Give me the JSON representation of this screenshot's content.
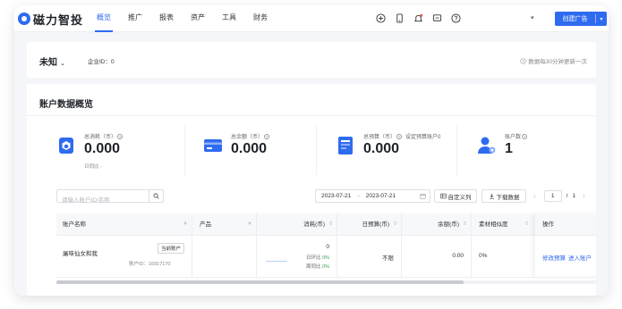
{
  "app": {
    "logo_text": "磁力智投",
    "nav": [
      "概览",
      "推广",
      "报表",
      "资产",
      "工具",
      "财务"
    ],
    "active_nav": "概览",
    "create_button": "创建广告",
    "user_caret": "▾",
    "top_icons": [
      "add-circle-icon",
      "phone-icon",
      "bell-icon",
      "message-icon",
      "help-icon"
    ]
  },
  "account": {
    "name": "未知",
    "id_label": "企业ID：",
    "id_value": "0",
    "refresh_note": "数据每30分钟更新一次"
  },
  "overview": {
    "title": "账户数据概览",
    "stats": [
      {
        "label": "总消耗（币）",
        "value": "0.000",
        "sub": "日同比 -",
        "icon": "cube-icon",
        "color": "#2f6bf0"
      },
      {
        "label": "总余额（币）",
        "value": "0.000",
        "sub": "",
        "icon": "wallet-card-icon",
        "color": "#2f6bf0"
      },
      {
        "label": "总预算（币）",
        "value": "0.000",
        "sub": "",
        "extra": "设定预算账户0",
        "icon": "budget-doc-icon",
        "color": "#2f6bf0"
      },
      {
        "label": "账户数",
        "value": "1",
        "sub": "",
        "icon": "user-settings-icon",
        "color": "#2f6bf0"
      }
    ]
  },
  "toolbar": {
    "search_placeholder": "请输入账户ID/名称",
    "date_start": "2023-07-21",
    "date_sep": "→",
    "date_end": "2023-07-21",
    "custom_columns": "自定义列",
    "download": "下载数据",
    "page_current": "1",
    "page_sep": "/",
    "page_total": "1",
    "prev": "‹",
    "next": "›"
  },
  "table": {
    "columns": [
      "账户名称",
      "产品",
      "消耗(币)",
      "日预算(币)",
      "余额(币)",
      "素材相似度",
      "操作"
    ],
    "row": {
      "account_name": "屠味仙女和我",
      "current_tag": "当前账户",
      "account_id": "账户ID：16917170",
      "product": "",
      "spend": "0",
      "day_compare": "日环比",
      "day_compare_val": "0%",
      "week_compare": "周同比",
      "week_compare_val": "0%",
      "budget": "不限",
      "balance": "0.00",
      "similarity": "0%",
      "action_edit": "修改预算",
      "action_enter": "进入账户"
    }
  }
}
